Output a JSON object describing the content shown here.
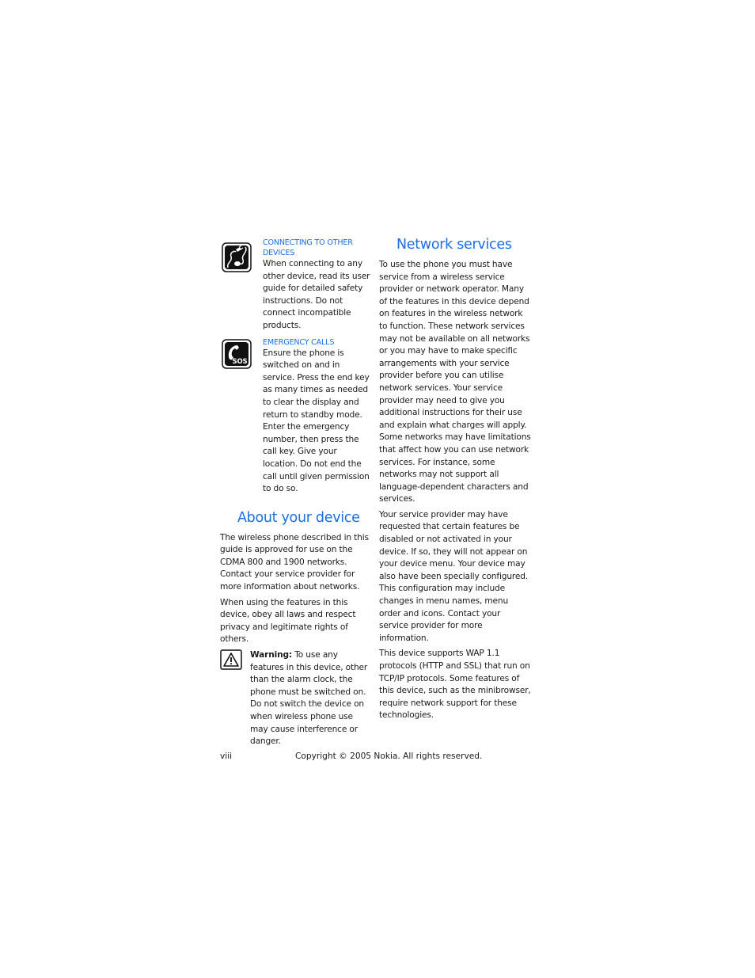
{
  "left_column": {
    "notices": [
      {
        "icon": "connecting-devices-icon",
        "title_line1": "CONNECTING TO OTHER",
        "title_line2": "DEVICES",
        "body": "When connecting to any other device, read its user guide for detailed safety instructions. Do not connect incompatible products."
      },
      {
        "icon": "emergency-calls-sos-icon",
        "title_line1": "EMERGENCY CALLS",
        "body": "Ensure the phone is switched on and in service. Press the end key as many times as needed to clear the display and return to standby mode. Enter the emergency number, then press the call key. Give your location. Do not end the call until given permission to do so."
      }
    ],
    "about": {
      "heading": "About your device",
      "paragraphs": [
        "The wireless phone described in this guide is approved for use on the CDMA 800 and 1900 networks. Contact your service provider for more information about networks.",
        "When using the features in this device, obey all laws and respect privacy and legitimate rights of others."
      ],
      "warning": {
        "icon": "warning-triangle-icon",
        "label": "Warning:",
        "text": " To use any features in this device, other than the alarm clock, the phone must be switched on. Do not switch the device on when wireless phone use may cause interference or danger."
      }
    }
  },
  "right_column": {
    "heading": "Network services",
    "paragraphs": [
      "To use the phone you must have service from a wireless service provider or network operator. Many of the features in this device depend on features in the wireless network to function. These network services may not be available on all networks or you may have to make specific arrangements with your service provider before you can utilise network services. Your service provider may need to give you additional instructions for their use and explain what charges will apply. Some networks may have limitations that affect how you can use network services. For instance, some networks may not support all language-dependent characters and services.",
      "Your service provider may have requested that certain features be disabled or not activated in your device. If so, they will not appear on your device menu. Your device may also have been specially configured. This configuration may include changes in menu names, menu order and icons. Contact your service provider for more information.",
      "This device supports WAP 1.1 protocols (HTTP and SSL) that run on TCP/IP protocols. Some features of this device, such as the minibrowser, require network support for these technologies."
    ]
  },
  "footer": {
    "page_number": "viii",
    "copyright": "Copyright © 2005 Nokia. All rights reserved."
  },
  "colors": {
    "heading_blue": "#1b6fe0",
    "text": "#1a1a1a"
  }
}
